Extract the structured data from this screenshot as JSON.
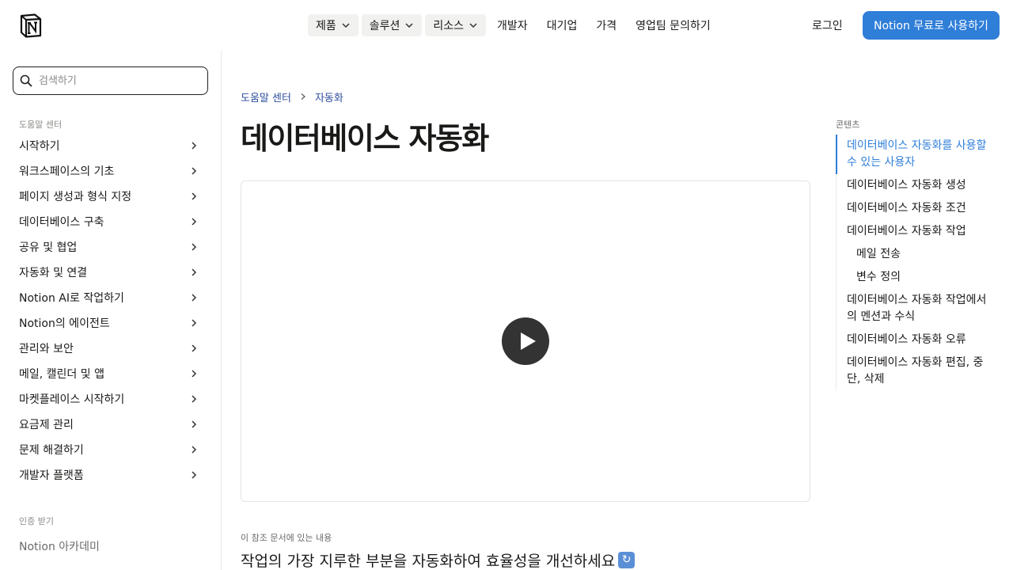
{
  "header": {
    "logo": "notion-logo",
    "nav": [
      {
        "label": "제품",
        "dropdown": true
      },
      {
        "label": "솔루션",
        "dropdown": true
      },
      {
        "label": "리소스",
        "dropdown": true
      },
      {
        "label": "개발자",
        "dropdown": false
      },
      {
        "label": "대기업",
        "dropdown": false
      },
      {
        "label": "가격",
        "dropdown": false
      },
      {
        "label": "영업팀 문의하기",
        "dropdown": false
      }
    ],
    "login": "로그인",
    "cta": "Notion 무료로 사용하기"
  },
  "sidebar": {
    "search_placeholder": "검색하기",
    "section_title": "도움말 센터",
    "items": [
      "시작하기",
      "워크스페이스의 기초",
      "페이지 생성과 형식 지정",
      "데이터베이스 구축",
      "공유 및 협업",
      "자동화 및 연결",
      "Notion AI로 작업하기",
      "Notion의 에이전트",
      "관리와 보안",
      "메일, 캘린더 및 앱",
      "마켓플레이스 시작하기",
      "요금제 관리",
      "문제 해결하기",
      "개발자 플랫폼"
    ],
    "certification_title": "인증 받기",
    "academy": "Notion 아카데미"
  },
  "main": {
    "breadcrumb": [
      "도움말 센터",
      "자동화"
    ],
    "title": "데이터베이스 자동화",
    "in_this_doc": "이 참조 문서에 있는 내용",
    "subheading": "작업의 가장 지루한 부분을 자동화하여 효율성을 개선하세요"
  },
  "toc": {
    "title": "콘텐츠",
    "items": [
      {
        "label": "데이터베이스 자동화를 사용할 수 있는 사용자",
        "sub": false,
        "active": true
      },
      {
        "label": "데이터베이스 자동화 생성",
        "sub": false,
        "active": false
      },
      {
        "label": "데이터베이스 자동화 조건",
        "sub": false,
        "active": false
      },
      {
        "label": "데이터베이스 자동화 작업",
        "sub": false,
        "active": false
      },
      {
        "label": "메일 전송",
        "sub": true,
        "active": false
      },
      {
        "label": "변수 정의",
        "sub": true,
        "active": false
      },
      {
        "label": "데이터베이스 자동화 작업에서의 멘션과 수식",
        "sub": false,
        "active": false
      },
      {
        "label": "데이터베이스 자동화 오류",
        "sub": false,
        "active": false
      },
      {
        "label": "데이터베이스 자동화 편집, 중단, 삭제",
        "sub": false,
        "active": false
      }
    ]
  },
  "colors": {
    "accent": "#2f7ed8",
    "breadcrumb_link": "#2e4e9e",
    "text": "#191918",
    "muted": "#8a8a87"
  }
}
